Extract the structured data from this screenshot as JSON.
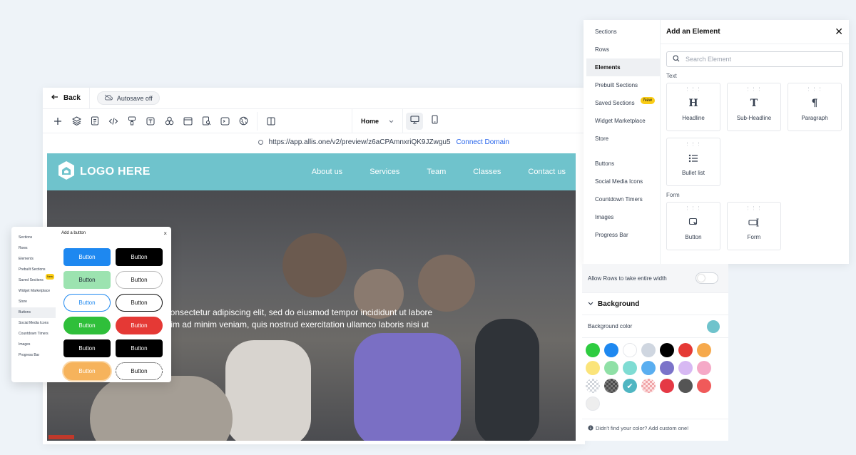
{
  "editor": {
    "back_label": "Back",
    "autosave_label": "Autosave off",
    "page_select": "Home",
    "url": "https://app.allis.one/v2/preview/z6aCPAmnxriQK9JZwgu5",
    "connect_domain": "Connect Domain"
  },
  "site": {
    "logo_text": "LOGO HERE",
    "nav": [
      "About us",
      "Services",
      "Team",
      "Classes",
      "Contact us"
    ],
    "hero_line1": ", consectetur adipiscing elit, sed do eiusmod tempor incididunt ut labore",
    "hero_line2": "enim ad minim veniam, quis nostrud exercitation ullamco laboris nisi ut"
  },
  "button_panel": {
    "title": "Add a button",
    "sidebar": [
      "Sections",
      "Rows",
      "Elements",
      "Prebuilt Sections",
      "Saved Sections",
      "Widget Marketplace",
      "Store",
      "Buttons",
      "Social Media Icons",
      "Countdown Timers",
      "Images",
      "Progress Bar"
    ],
    "new_badge": "New",
    "button_label": "Button",
    "styles": [
      {
        "bg": "#1e88f0",
        "fg": "#ffffff",
        "border": "#1e88f0"
      },
      {
        "bg": "#000000",
        "fg": "#ffffff",
        "border": "#000000"
      },
      {
        "bg": "#9ce3b0",
        "fg": "#1f2937",
        "border": "#9ce3b0"
      },
      {
        "bg": "#ffffff",
        "fg": "#111111",
        "border": "#bdbdbd"
      },
      {
        "bg": "#ffffff",
        "fg": "#1e88f0",
        "border": "#1e88f0"
      },
      {
        "bg": "#ffffff",
        "fg": "#111111",
        "border": "#111111"
      },
      {
        "bg": "#2fbf3a",
        "fg": "#ffffff",
        "border": "#2fbf3a"
      },
      {
        "bg": "#e53935",
        "fg": "#ffffff",
        "border": "#e53935"
      },
      {
        "bg": "#000000",
        "fg": "#ffffff",
        "border": "#000000"
      },
      {
        "bg": "#000000",
        "fg": "#ffffff",
        "border": "#000000"
      },
      {
        "bg": "#f6b35c",
        "fg": "#ffffff",
        "border": "#f6b35c"
      },
      {
        "bg": "#ffffff",
        "fg": "#111111",
        "border": "#111111"
      }
    ]
  },
  "element_panel": {
    "title": "Add an Element",
    "search_placeholder": "Search Element",
    "sidebar": [
      "Sections",
      "Rows",
      "Elements",
      "Prebuilt Sections",
      "Saved Sections",
      "Widget Marketplace",
      "Store",
      "Buttons",
      "Social Media Icons",
      "Countdown Timers",
      "Images",
      "Progress Bar"
    ],
    "new_badge": "New",
    "text_section": "Text",
    "text_items": [
      {
        "label": "Headline",
        "icon": "H"
      },
      {
        "label": "Sub-Headline",
        "icon": "T"
      },
      {
        "label": "Paragraph",
        "icon": "¶"
      },
      {
        "label": "Bullet list",
        "icon": "bullet-list"
      }
    ],
    "form_section": "Form",
    "form_items": [
      {
        "label": "Button",
        "icon": "cursor-button"
      },
      {
        "label": "Form",
        "icon": "form-input"
      }
    ]
  },
  "background_panel": {
    "rows_label": "Allow Rows to take entire width",
    "section_title": "Background",
    "color_label": "Background color",
    "current_color": "#6fc3cc",
    "swatches": [
      "#2ecc40",
      "#1e88f0",
      "#ffffff",
      "#cfd6e0",
      "#000000",
      "#e53935",
      "#f6a94c",
      "#fbe47a",
      "#8fe0a6",
      "#7fdcd3",
      "#5aaef0",
      "#7b73c9",
      "#d7b8f3",
      "#f5a9c7",
      "checker",
      "checker-dark",
      "#4fb6c2",
      "checker-red",
      "#e53945",
      "#555555",
      "#f05a5a",
      "#eeeeee"
    ],
    "selected_index": 16,
    "footer": "Didn't find your color? Add custom one!"
  }
}
